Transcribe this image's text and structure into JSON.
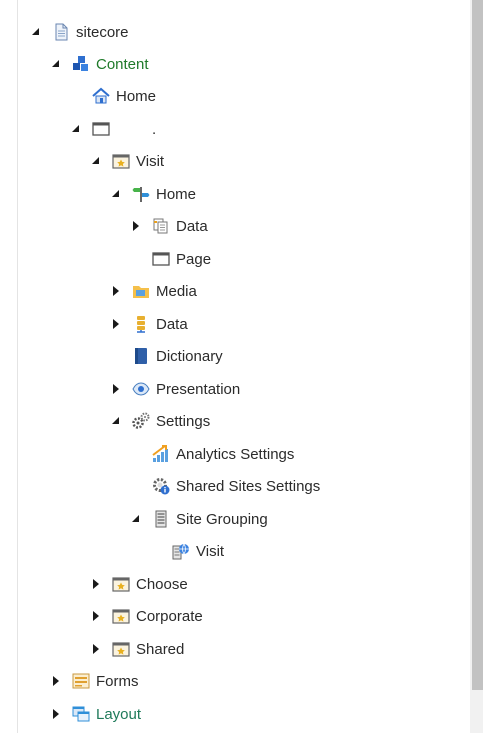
{
  "tree": {
    "sitecore": "sitecore",
    "content": "Content",
    "home_root": "Home",
    "unnamed_site": ".",
    "visit": "Visit",
    "visit_home": "Home",
    "data": "Data",
    "page": "Page",
    "media": "Media",
    "data2": "Data",
    "dictionary": "Dictionary",
    "presentation": "Presentation",
    "settings": "Settings",
    "analytics_settings": "Analytics Settings",
    "shared_sites_settings": "Shared Sites Settings",
    "site_grouping": "Site Grouping",
    "site_grouping_visit": "Visit",
    "choose": "Choose",
    "corporate": "Corporate",
    "shared": "Shared",
    "forms": "Forms",
    "layout": "Layout"
  },
  "colors": {
    "content_label": "#1f7a2a",
    "layout_label": "#1f7a5a",
    "text": "#2b2b2b",
    "scrollbar_thumb": "#c2c2c2"
  }
}
